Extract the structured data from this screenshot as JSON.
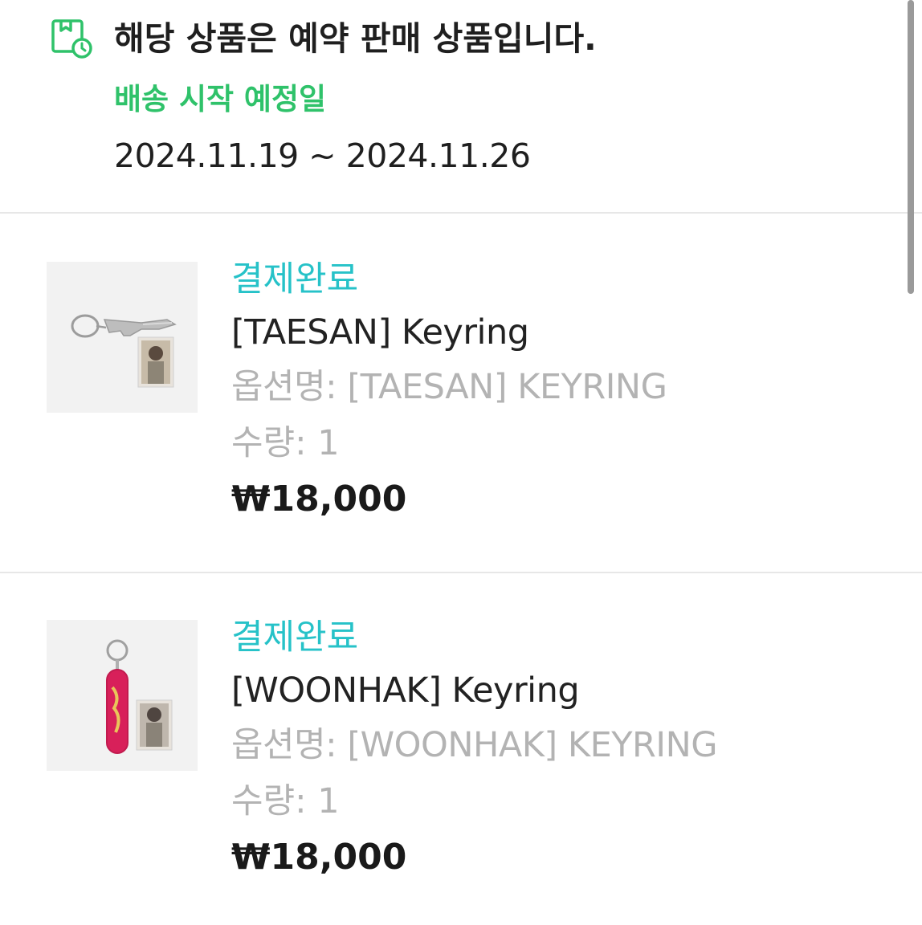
{
  "notice": {
    "icon": "delivery-box-clock-icon",
    "title": "해당 상품은 예약 판매 상품입니다.",
    "shipping_label": "배송 시작 예정일",
    "shipping_dates": "2024.11.19 ~ 2024.11.26",
    "accent_color": "#2fc26a"
  },
  "orders": [
    {
      "status": "결제완료",
      "name": "[TAESAN] Keyring",
      "option": "옵션명: [TAESAN] KEYRING",
      "quantity": "수량: 1",
      "price": "₩18,000",
      "thumbnail_icon": "keyring-hand-photo-image"
    },
    {
      "status": "결제완료",
      "name": "[WOONHAK] Keyring",
      "option": "옵션명: [WOONHAK] KEYRING",
      "quantity": "수량: 1",
      "price": "₩18,000",
      "thumbnail_icon": "keyring-skateboard-photo-image"
    }
  ],
  "colors": {
    "status": "#26c2c8",
    "muted": "#b3b3b3",
    "divider": "#e7e7e7"
  }
}
